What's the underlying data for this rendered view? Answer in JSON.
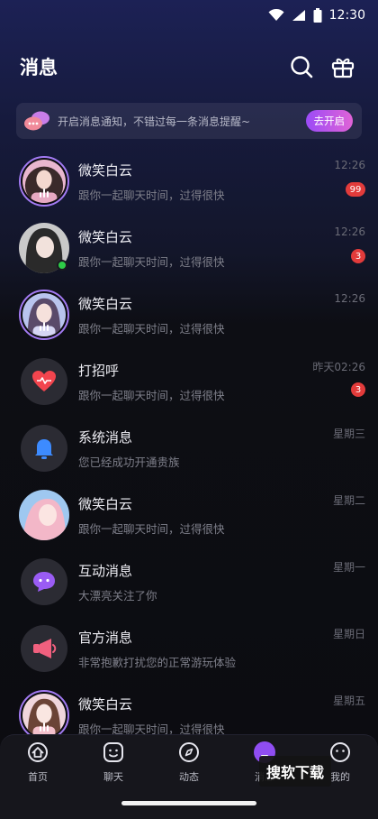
{
  "status_bar": {
    "time": "12:30"
  },
  "header": {
    "title": "消息",
    "search_icon": "search-icon",
    "gift_icon": "gift-icon"
  },
  "notice": {
    "text": "开启消息通知，不错过每一条消息提醒~",
    "button": "去开启"
  },
  "conversations": [
    {
      "name": "微笑白云",
      "preview": "跟你一起聊天时间，过得很快",
      "time": "12:26",
      "badge": "99",
      "avatar": "woman-photo-live"
    },
    {
      "name": "微笑白云",
      "preview": "跟你一起聊天时间，过得很快",
      "time": "12:26",
      "badge": "3",
      "avatar": "woman-photo-online"
    },
    {
      "name": "微笑白云",
      "preview": "跟你一起聊天时间，过得很快",
      "time": "12:26",
      "badge": "",
      "avatar": "woman-photo-live"
    },
    {
      "name": "打招呼",
      "preview": "跟你一起聊天时间，过得很快",
      "time": "昨天02:26",
      "badge": "3",
      "avatar": "heart-icon"
    },
    {
      "name": "系统消息",
      "preview": "您已经成功开通贵族",
      "time": "星期三",
      "badge": "",
      "avatar": "bell-icon"
    },
    {
      "name": "微笑白云",
      "preview": "跟你一起聊天时间，过得很快",
      "time": "星期二",
      "badge": "",
      "avatar": "woman-photo"
    },
    {
      "name": "互动消息",
      "preview": "大漂亮关注了你",
      "time": "星期一",
      "badge": "",
      "avatar": "chat-bubble-icon"
    },
    {
      "name": "官方消息",
      "preview": "非常抱歉打扰您的正常游玩体验",
      "time": "星期日",
      "badge": "",
      "avatar": "megaphone-icon"
    },
    {
      "name": "微笑白云",
      "preview": "跟你一起聊天时间，过得很快",
      "time": "星期五",
      "badge": "",
      "avatar": "woman-photo-live"
    }
  ],
  "tabbar": {
    "tabs": [
      {
        "label": "首页",
        "icon": "home-icon"
      },
      {
        "label": "聊天",
        "icon": "smile-icon"
      },
      {
        "label": "动态",
        "icon": "compass-icon"
      },
      {
        "label": "消息",
        "icon": "message-icon",
        "active": true
      },
      {
        "label": "我的",
        "icon": "profile-icon"
      }
    ]
  },
  "watermark": "搜软下载",
  "colors": {
    "accent_purple": "#9b4bf7",
    "accent_pink": "#e063d6",
    "badge_red": "#e23b3b",
    "online_green": "#2ecc48"
  }
}
